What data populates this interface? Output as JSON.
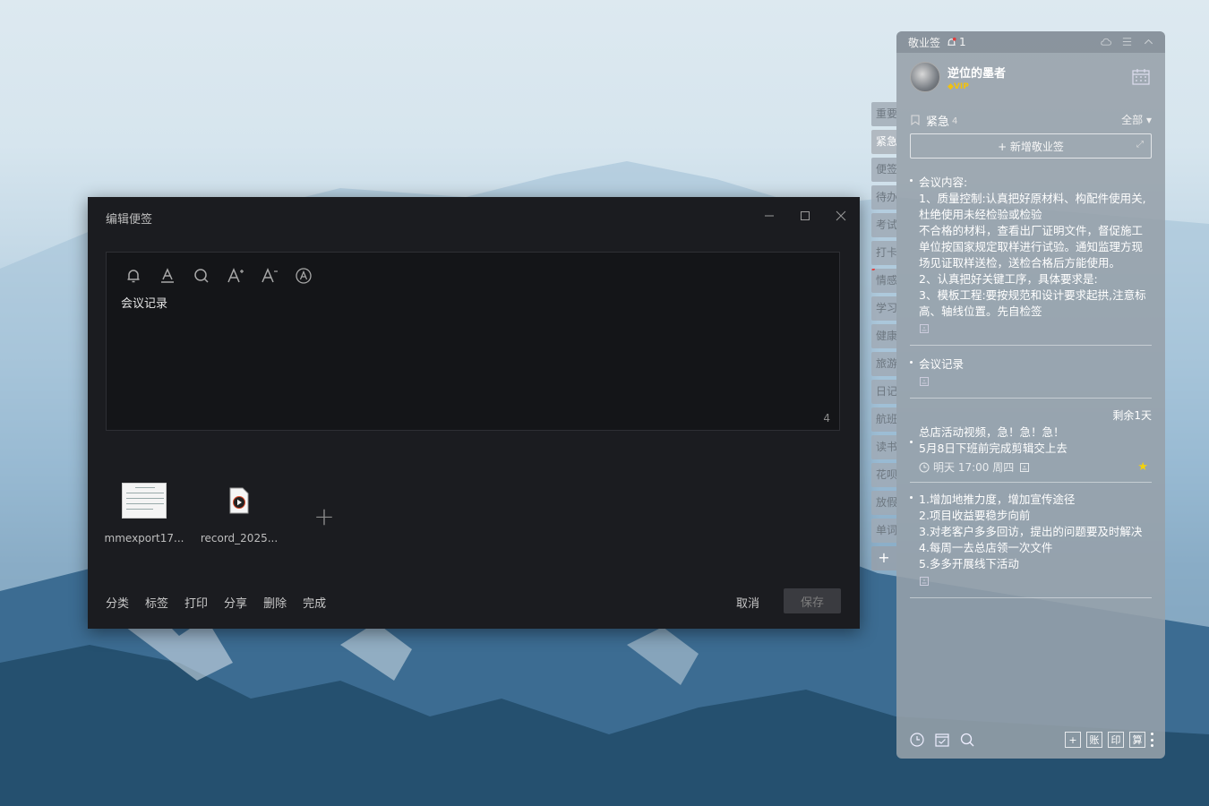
{
  "colors": {
    "editor_bg": "#1b1c20",
    "panel_bg": "#96a0aa",
    "star": "#f4d20a",
    "vip": "#f2c20d"
  },
  "editor": {
    "title": "编辑便签",
    "controls": [
      "minimize-icon",
      "maximize-icon",
      "close-icon"
    ],
    "toolbar": [
      "bell-icon",
      "text-color-icon",
      "search-icon",
      "font-increase-icon",
      "font-decrease-icon",
      "clear-format-icon"
    ],
    "content": "会议记录",
    "char_count": "4",
    "attachments": [
      {
        "name": "mmexport17...",
        "type": "image"
      },
      {
        "name": "record_2025...",
        "type": "video"
      }
    ],
    "add_attachment": "+",
    "actions": [
      "分类",
      "标签",
      "打印",
      "分享",
      "删除",
      "完成"
    ],
    "cancel": "取消",
    "save": "保存"
  },
  "tabs": {
    "items": [
      "重要",
      "紧急",
      "便签",
      "待办",
      "考试",
      "打卡",
      "情感",
      "学习",
      "健康",
      "旅游",
      "日记",
      "航班",
      "读书",
      "花呗",
      "放假",
      "单词"
    ],
    "active": "紧急",
    "add": "+"
  },
  "panel": {
    "app_name": "敬业签",
    "bell_count": "1",
    "user": {
      "name": "逆位的墨者",
      "badge": "VIP"
    },
    "category": {
      "name": "紧急",
      "count": "4"
    },
    "filter": "全部 ▾",
    "new_button": "+ 新增敬业签",
    "notes": [
      {
        "lines": [
          "会议内容:",
          "1、质量控制:认真把好原材料、构配件使用关,杜绝使用未经检验或检验",
          "不合格的材料，查看出厂证明文件，督促施工单位按国家规定取样进行试验。通知监理方现场见证取样送检，送检合格后方能使用。",
          "2、认真把好关键工序，具体要求是:",
          "3、模板工程:要按规范和设计要求起拱,注意标高、轴线位置。先自检签"
        ]
      },
      {
        "lines": [
          "会议记录"
        ]
      },
      {
        "remaining": "剩余1天",
        "lines": [
          "总店活动视频，急！急！急！",
          "5月8日下班前完成剪辑交上去"
        ],
        "due": "明天 17:00 周四",
        "starred": true
      },
      {
        "lines": [
          "1.增加地推力度，增加宣传途径",
          "2.项目收益要稳步向前",
          "3.对老客户多多回访，提出的问题要及时解决",
          "4.每周一去总店领一次文件",
          "5.多多开展线下活动"
        ]
      }
    ],
    "bottom_left": [
      "clock-icon",
      "checklist-icon",
      "search-icon"
    ],
    "bottom_right": [
      "+",
      "账",
      "印",
      "算"
    ]
  }
}
